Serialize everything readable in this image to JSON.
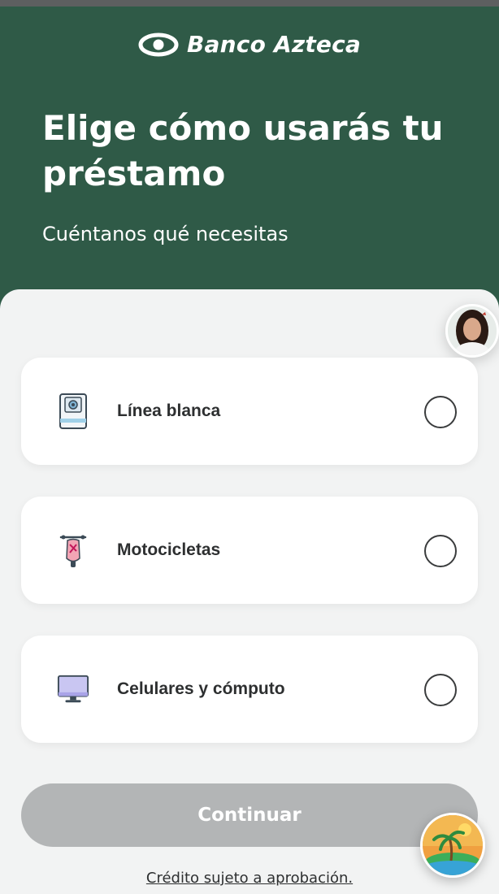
{
  "brand": {
    "name": "Banco Azteca",
    "logo_icon": "eye-logo-icon"
  },
  "header": {
    "title": "Elige cómo usarás tu préstamo",
    "subtitle": "Cuéntanos qué necesitas"
  },
  "options": [
    {
      "label": "Línea blanca",
      "icon": "washing-machine-icon",
      "selected": false
    },
    {
      "label": "Motocicletas",
      "icon": "motorcycle-icon",
      "selected": false
    },
    {
      "label": "Celulares y cómputo",
      "icon": "computer-monitor-icon",
      "selected": false
    }
  ],
  "actions": {
    "continue_label": "Continuar",
    "continue_enabled": false
  },
  "footer": {
    "disclaimer": "Crédito sujeto a aprobación."
  },
  "widgets": {
    "assistant_icon": "assistant-avatar-icon",
    "promo_icon": "beach-promo-icon"
  },
  "colors": {
    "header_bg": "#2f5a47",
    "page_bg": "#f2f3f3",
    "card_bg": "#ffffff",
    "button_disabled": "#b3b5b6",
    "text_dark": "#2d2f30"
  }
}
